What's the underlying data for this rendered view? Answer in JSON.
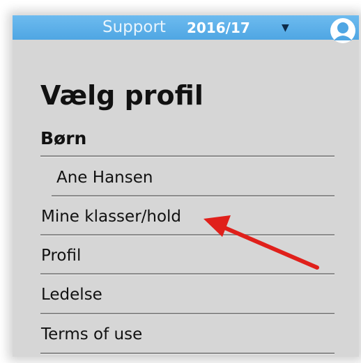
{
  "topbar": {
    "support_label": "Support",
    "year_label": "2016/17",
    "dropdown_caret": "▼",
    "user_icon": "user-icon"
  },
  "panel": {
    "title": "Vælg profil",
    "group_label": "Børn",
    "child_item": "Ane Hansen",
    "items": [
      "Mine klasser/hold",
      "Profil",
      "Ledelse",
      "Terms of use"
    ]
  },
  "annotation": {
    "arrow_color": "#e0201b"
  },
  "colors": {
    "topbar": "#58abe6",
    "panel_background": "#d6d6d6",
    "text": "#111111"
  }
}
